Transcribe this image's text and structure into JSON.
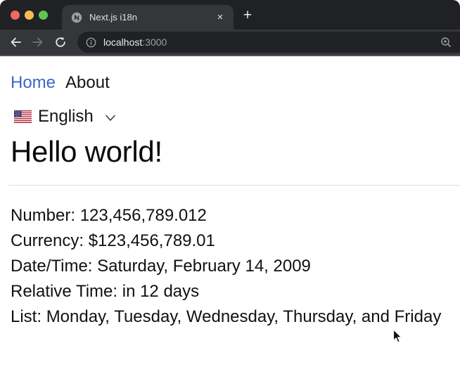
{
  "browser": {
    "tab": {
      "title": "Next.js i18n",
      "close_label": "×",
      "favicon": "nextjs-globe-icon"
    },
    "new_tab_label": "+",
    "traffic_lights": [
      "close",
      "minimize",
      "fullscreen"
    ],
    "toolbar_icons": [
      "back-arrow",
      "forward-arrow",
      "reload",
      "page-info",
      "zoom-level"
    ],
    "url": {
      "host": "localhost",
      "port": ":3000"
    }
  },
  "page": {
    "nav": {
      "home_label": "Home",
      "about_label": "About"
    },
    "language_selector": {
      "flag": "us-flag",
      "selected": "English"
    },
    "heading": "Hello world!",
    "info_lines": [
      {
        "label": "Number:",
        "value": "123,456,789.012"
      },
      {
        "label": "Currency:",
        "value": "$123,456,789.01"
      },
      {
        "label": "Date/Time:",
        "value": "Saturday, February 14, 2009"
      },
      {
        "label": "Relative Time:",
        "value": "in 12 days"
      },
      {
        "label": "List:",
        "value": "Monday, Tuesday, Wednesday, Thursday, and Friday"
      }
    ]
  },
  "colors": {
    "link_blue": "#3b66cc",
    "chrome_frame": "#202124",
    "chrome_toolbar": "#35363a",
    "omnibox_bg": "#202124",
    "traffic_red": "#ee6a5f",
    "traffic_yellow": "#f5bd4f",
    "traffic_green": "#61c554",
    "rule_gray": "#e3e3e3"
  }
}
